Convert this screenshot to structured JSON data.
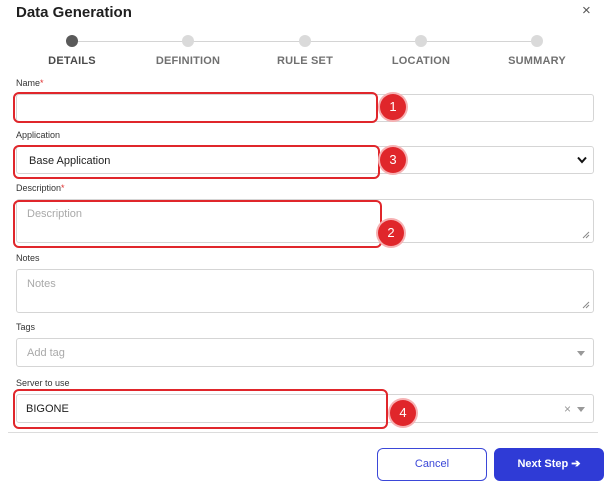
{
  "dialog": {
    "title": "Data Generation",
    "close_glyph": "×"
  },
  "steps": [
    {
      "label": "DETAILS",
      "active": true
    },
    {
      "label": "DEFINITION",
      "active": false
    },
    {
      "label": "RULE SET",
      "active": false
    },
    {
      "label": "LOCATION",
      "active": false
    },
    {
      "label": "SUMMARY",
      "active": false
    }
  ],
  "form": {
    "name": {
      "label": "Name",
      "required_mark": "*",
      "value": ""
    },
    "application": {
      "label": "Application",
      "value": "Base Application"
    },
    "description": {
      "label": "Description",
      "required_mark": "*",
      "placeholder": "Description"
    },
    "notes": {
      "label": "Notes",
      "placeholder": "Notes"
    },
    "tags": {
      "label": "Tags",
      "placeholder": "Add tag"
    },
    "server": {
      "label": "Server to use",
      "value": "BIGONE",
      "clear_glyph": "×"
    }
  },
  "annotations": {
    "name_badge": "1",
    "description_badge": "2",
    "application_badge": "3",
    "server_badge": "4"
  },
  "footer": {
    "cancel_label": "Cancel",
    "next_label": "Next Step ➔"
  },
  "colors": {
    "accent": "#2f3bd6",
    "callout": "#e0262b",
    "required": "#e03030"
  }
}
